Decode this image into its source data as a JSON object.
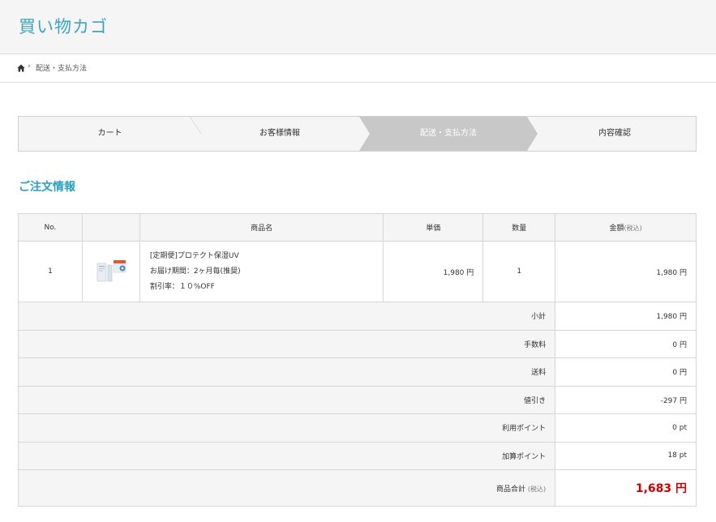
{
  "header": {
    "title": "買い物カゴ"
  },
  "breadcrumb": {
    "home_icon": "home-icon",
    "separator": "›",
    "current": "配送・支払方法"
  },
  "steps": [
    {
      "label": "カート",
      "active": false
    },
    {
      "label": "お客様情報",
      "active": false
    },
    {
      "label": "配送・支払方法",
      "active": true
    },
    {
      "label": "内容確認",
      "active": false
    }
  ],
  "colors": {
    "accent": "#2aa1c0",
    "active_step": "#c8c8c8",
    "total": "#cc0000"
  },
  "section": {
    "title": "ご注文情報"
  },
  "table": {
    "headers": {
      "no": "No.",
      "image": "",
      "name": "商品名",
      "unit_price": "単価",
      "quantity": "数量",
      "amount": "金額",
      "amount_note": "(税込)"
    },
    "items": [
      {
        "no": "1",
        "name_line1": "[定期便]プロテクト保湿UV",
        "name_line2": "お届け期間：2ヶ月毎(推奨)",
        "name_line3": "割引率：１０%OFF",
        "unit_price": "1,980 円",
        "quantity": "1",
        "amount": "1,980 円"
      }
    ],
    "summary": [
      {
        "label": "小計",
        "value": "1,980 円"
      },
      {
        "label": "手数料",
        "value": "0 円"
      },
      {
        "label": "送料",
        "value": "0 円"
      },
      {
        "label": "値引き",
        "value": "-297 円"
      },
      {
        "label": "利用ポイント",
        "value": "0 pt"
      },
      {
        "label": "加算ポイント",
        "value": "18 pt"
      }
    ],
    "total": {
      "label": "商品合計",
      "note": "(税込)",
      "value": "1,683 円"
    }
  }
}
